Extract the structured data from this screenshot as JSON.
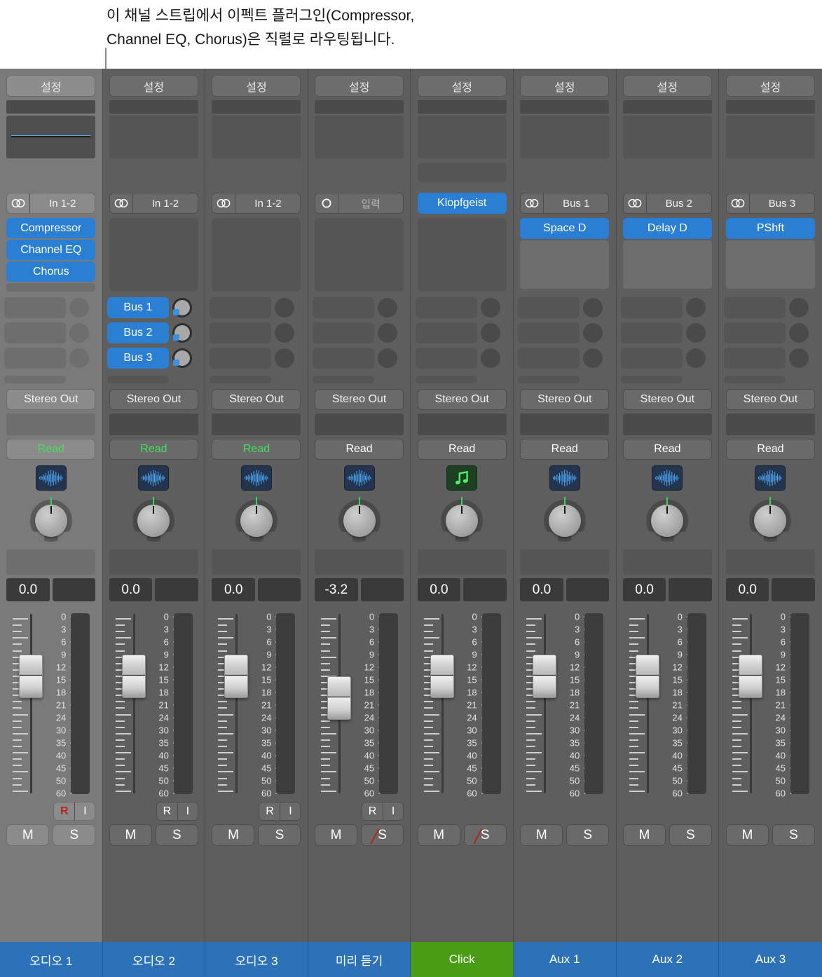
{
  "callout": {
    "text": "이 채널 스트립에서 이펙트 플러그인(Compressor,\nChannel EQ, Chorus)은 직렬로 라우팅됩니다."
  },
  "common": {
    "setting_label": "설정",
    "output_label": "Stereo Out",
    "automation_read": "Read",
    "mute_label": "M",
    "solo_label": "S",
    "record_label": "R",
    "input_monitor_label": "I"
  },
  "scale": {
    "ticks": [
      "0",
      "3",
      "6",
      "9",
      "12",
      "15",
      "18",
      "21",
      "24",
      "30",
      "35",
      "40",
      "45",
      "50",
      "60"
    ]
  },
  "colors": {
    "accent_blue": "#2a7fd4",
    "name_blue": "#2d72b8",
    "click_green": "#4a9c16",
    "read_green": "#44e05a",
    "record_red": "#b32b1e",
    "strip_bg": "#5e5e5e",
    "strip_selected_bg": "#7a7a7a"
  },
  "channels": [
    {
      "name": "오디오 1",
      "name_color": "blue",
      "selected": true,
      "setting": "설정",
      "has_eq_display": true,
      "has_midi_slot": false,
      "input": {
        "type": "stereo",
        "icon": "stereo-circles-icon",
        "label": "In 1-2",
        "highlight": false,
        "dim": false
      },
      "plugins": [
        "Compressor",
        "Channel EQ",
        "Chorus"
      ],
      "sends": [
        {
          "label": "",
          "active": false
        },
        {
          "label": "",
          "active": false
        },
        {
          "label": "",
          "active": false
        }
      ],
      "output": "Stereo Out",
      "automation": "Read",
      "automation_green": true,
      "track_icon": "audio-waveform-icon",
      "volume": "0.0",
      "fader_pos": 0.3,
      "record_enabled": true,
      "has_record_row": true,
      "solo_crossed": false
    },
    {
      "name": "오디오 2",
      "name_color": "blue",
      "selected": false,
      "setting": "설정",
      "has_eq_display": true,
      "has_midi_slot": false,
      "input": {
        "type": "stereo",
        "icon": "stereo-circles-icon",
        "label": "In 1-2",
        "highlight": false,
        "dim": false
      },
      "plugins": [],
      "sends": [
        {
          "label": "Bus 1",
          "active": true
        },
        {
          "label": "Bus 2",
          "active": true
        },
        {
          "label": "Bus 3",
          "active": true
        }
      ],
      "output": "Stereo Out",
      "automation": "Read",
      "automation_green": true,
      "track_icon": "audio-waveform-icon",
      "volume": "0.0",
      "fader_pos": 0.3,
      "record_enabled": false,
      "has_record_row": true,
      "solo_crossed": false
    },
    {
      "name": "오디오 3",
      "name_color": "blue",
      "selected": false,
      "setting": "설정",
      "has_eq_display": true,
      "has_midi_slot": false,
      "input": {
        "type": "stereo",
        "icon": "stereo-circles-icon",
        "label": "In 1-2",
        "highlight": false,
        "dim": false
      },
      "plugins": [],
      "sends": [
        {
          "label": "",
          "active": false
        },
        {
          "label": "",
          "active": false
        },
        {
          "label": "",
          "active": false
        }
      ],
      "output": "Stereo Out",
      "automation": "Read",
      "automation_green": true,
      "track_icon": "audio-waveform-icon",
      "volume": "0.0",
      "fader_pos": 0.3,
      "record_enabled": false,
      "has_record_row": true,
      "solo_crossed": false
    },
    {
      "name": "미리 듣기",
      "name_color": "blue",
      "selected": false,
      "setting": "설정",
      "has_eq_display": true,
      "has_midi_slot": false,
      "input": {
        "type": "mono",
        "icon": "mono-circle-icon",
        "label": "입력",
        "highlight": false,
        "dim": true
      },
      "plugins": [],
      "sends": [
        {
          "label": "",
          "active": false
        },
        {
          "label": "",
          "active": false
        },
        {
          "label": "",
          "active": false
        }
      ],
      "output": "Stereo Out",
      "automation": "Read",
      "automation_green": false,
      "track_icon": "audio-waveform-icon",
      "volume": "-3.2",
      "fader_pos": 0.46,
      "record_enabled": false,
      "has_record_row": true,
      "solo_crossed": true
    },
    {
      "name": "Click",
      "name_color": "green",
      "selected": false,
      "setting": "설정",
      "has_eq_display": true,
      "has_midi_slot": true,
      "input": {
        "type": "instrument",
        "icon": "",
        "label": "Klopfgeist",
        "highlight": true,
        "dim": false
      },
      "plugins": [],
      "sends": [
        {
          "label": "",
          "active": false
        },
        {
          "label": "",
          "active": false
        },
        {
          "label": "",
          "active": false
        }
      ],
      "output": "Stereo Out",
      "automation": "Read",
      "automation_green": false,
      "track_icon": "music-note-icon",
      "volume": "0.0",
      "fader_pos": 0.3,
      "record_enabled": false,
      "has_record_row": false,
      "solo_crossed": true
    },
    {
      "name": "Aux 1",
      "name_color": "blue",
      "selected": false,
      "setting": "설정",
      "has_eq_display": true,
      "has_midi_slot": false,
      "input": {
        "type": "stereo",
        "icon": "stereo-circles-icon",
        "label": "Bus 1",
        "highlight": false,
        "dim": false
      },
      "plugins": [
        "Space D"
      ],
      "sends": [
        {
          "label": "",
          "active": false
        },
        {
          "label": "",
          "active": false
        },
        {
          "label": "",
          "active": false
        }
      ],
      "output": "Stereo Out",
      "automation": "Read",
      "automation_green": false,
      "track_icon": "audio-waveform-icon",
      "volume": "0.0",
      "fader_pos": 0.3,
      "record_enabled": false,
      "has_record_row": false,
      "solo_crossed": false
    },
    {
      "name": "Aux 2",
      "name_color": "blue",
      "selected": false,
      "setting": "설정",
      "has_eq_display": true,
      "has_midi_slot": false,
      "input": {
        "type": "stereo",
        "icon": "stereo-circles-icon",
        "label": "Bus 2",
        "highlight": false,
        "dim": false
      },
      "plugins": [
        "Delay D"
      ],
      "sends": [
        {
          "label": "",
          "active": false
        },
        {
          "label": "",
          "active": false
        },
        {
          "label": "",
          "active": false
        }
      ],
      "output": "Stereo Out",
      "automation": "Read",
      "automation_green": false,
      "track_icon": "audio-waveform-icon",
      "volume": "0.0",
      "fader_pos": 0.3,
      "record_enabled": false,
      "has_record_row": false,
      "solo_crossed": false
    },
    {
      "name": "Aux 3",
      "name_color": "blue",
      "selected": false,
      "setting": "설정",
      "has_eq_display": true,
      "has_midi_slot": false,
      "input": {
        "type": "stereo",
        "icon": "stereo-circles-icon",
        "label": "Bus 3",
        "highlight": false,
        "dim": false
      },
      "plugins": [
        "PShft"
      ],
      "sends": [
        {
          "label": "",
          "active": false
        },
        {
          "label": "",
          "active": false
        },
        {
          "label": "",
          "active": false
        }
      ],
      "output": "Stereo Out",
      "automation": "Read",
      "automation_green": false,
      "track_icon": "audio-waveform-icon",
      "volume": "0.0",
      "fader_pos": 0.3,
      "record_enabled": false,
      "has_record_row": false,
      "solo_crossed": false
    }
  ]
}
